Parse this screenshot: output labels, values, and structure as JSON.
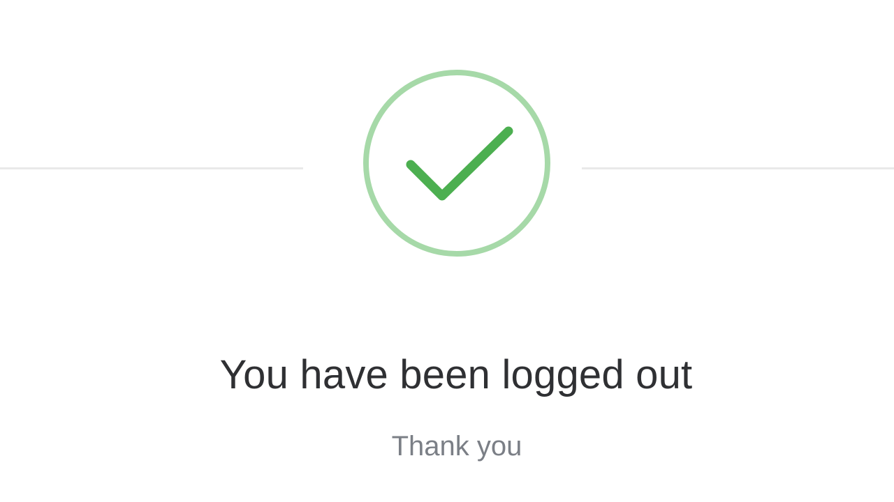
{
  "status": {
    "icon": "check-circle-icon",
    "ring_color": "#a6d9a8",
    "check_color": "#4caf50",
    "divider_color": "#e9e9e9"
  },
  "message": {
    "title": "You have been logged out",
    "subtitle": "Thank you"
  }
}
